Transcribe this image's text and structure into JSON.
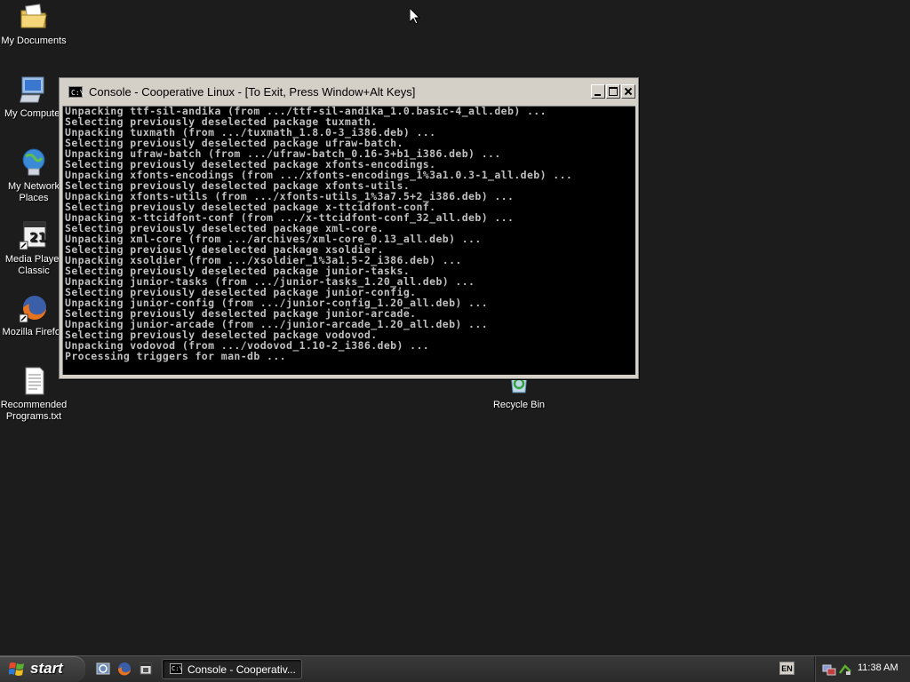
{
  "desktop": {
    "icons": [
      {
        "label": "My Documents"
      },
      {
        "label": "My Computer"
      },
      {
        "label": "My Network Places"
      },
      {
        "label": "Media Player Classic"
      },
      {
        "label": "Mozilla Firefox"
      },
      {
        "label": "Recommended Programs.txt"
      },
      {
        "label": "Recycle Bin"
      }
    ]
  },
  "console": {
    "title": "Console - Cooperative Linux - [To Exit, Press Window+Alt Keys]",
    "icon_text": "C:\\",
    "lines": [
      "Unpacking ttf-sil-andika (from .../ttf-sil-andika_1.0.basic-4_all.deb) ...",
      "Selecting previously deselected package tuxmath.",
      "Unpacking tuxmath (from .../tuxmath_1.8.0-3_i386.deb) ...",
      "Selecting previously deselected package ufraw-batch.",
      "Unpacking ufraw-batch (from .../ufraw-batch_0.16-3+b1_i386.deb) ...",
      "Selecting previously deselected package xfonts-encodings.",
      "Unpacking xfonts-encodings (from .../xfonts-encodings_1%3a1.0.3-1_all.deb) ...",
      "Selecting previously deselected package xfonts-utils.",
      "Unpacking xfonts-utils (from .../xfonts-utils_1%3a7.5+2_i386.deb) ...",
      "Selecting previously deselected package x-ttcidfont-conf.",
      "Unpacking x-ttcidfont-conf (from .../x-ttcidfont-conf_32_all.deb) ...",
      "Selecting previously deselected package xml-core.",
      "Unpacking xml-core (from .../archives/xml-core_0.13_all.deb) ...",
      "Selecting previously deselected package xsoldier.",
      "Unpacking xsoldier (from .../xsoldier_1%3a1.5-2_i386.deb) ...",
      "Selecting previously deselected package junior-tasks.",
      "Unpacking junior-tasks (from .../junior-tasks_1.20_all.deb) ...",
      "Selecting previously deselected package junior-config.",
      "Unpacking junior-config (from .../junior-config_1.20_all.deb) ...",
      "Selecting previously deselected package junior-arcade.",
      "Unpacking junior-arcade (from .../junior-arcade_1.20_all.deb) ...",
      "Selecting previously deselected package vodovod.",
      "Unpacking vodovod (from .../vodovod_1.10-2_i386.deb) ...",
      "Processing triggers for man-db ..."
    ]
  },
  "taskbar": {
    "start_label": "start",
    "quick_launch": [
      "ie-icon",
      "firefox-icon",
      "media-player-icon"
    ],
    "task_console_label": "Console - Cooperativ...",
    "task_console_icon_text": "C:\\",
    "language": "EN",
    "clock": "11:38 AM"
  },
  "colors": {
    "desktop_bg": "#1c1c1c",
    "console_bg": "#000000",
    "console_text": "#c0c0c0",
    "window_frame": "#d4d0c8",
    "taskbar_bg": "#2f2f2f"
  }
}
